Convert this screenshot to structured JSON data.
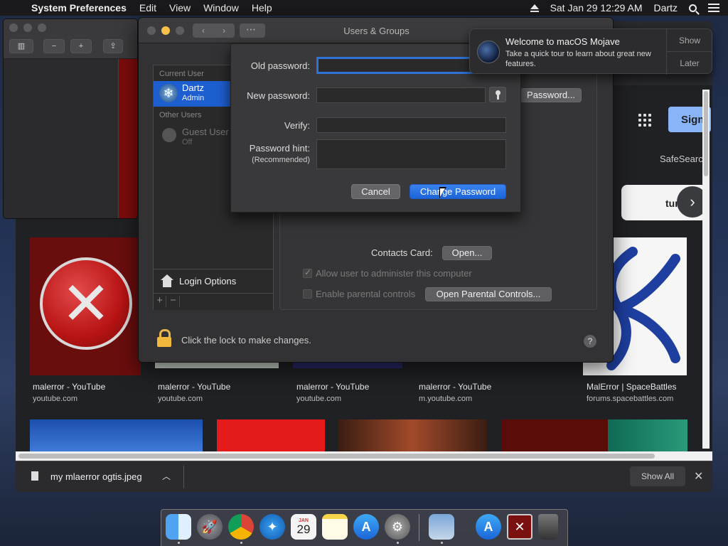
{
  "menubar": {
    "app_name": "System Preferences",
    "menus": [
      "Edit",
      "View",
      "Window",
      "Help"
    ],
    "clock": "Sat Jan 29  12:29 AM",
    "user": "Dartz"
  },
  "browser": {
    "results": [
      {
        "title": "malerror - YouTube",
        "source": "youtube.com"
      },
      {
        "title": "malerror - YouTube",
        "source": "youtube.com"
      },
      {
        "title": "malerror - YouTube",
        "source": "youtube.com"
      },
      {
        "title": "malerror - YouTube",
        "source": "m.youtube.com"
      },
      {
        "title": "MalError | SpaceBattles",
        "source": "forums.spacebattles.com"
      }
    ],
    "sign_in_label": "Sign",
    "safesearch_label": "SafeSearch",
    "chip_label": "tur",
    "download": {
      "file_name": "my mlaerror ogtis.jpeg",
      "show_all_label": "Show All"
    }
  },
  "users_groups": {
    "window_title": "Users & Groups",
    "current_user_header": "Current User",
    "current_user_name": "Dartz",
    "current_user_role": "Admin",
    "other_users_header": "Other Users",
    "guest_name": "Guest User",
    "guest_status": "Off",
    "login_options_label": "Login Options",
    "change_password_partial": "Password...",
    "contacts_card_label": "Contacts Card:",
    "open_button": "Open...",
    "allow_admin_label": "Allow user to administer this computer",
    "allow_admin_checked": true,
    "parental_controls_label": "Enable parental controls",
    "parental_controls_checked": false,
    "open_parental_button": "Open Parental Controls...",
    "lock_text": "Click the lock to make changes.",
    "help_label": "?"
  },
  "change_password_sheet": {
    "old_password_label": "Old password:",
    "old_password_value": "",
    "new_password_label": "New password:",
    "new_password_value": "",
    "verify_label": "Verify:",
    "verify_value": "",
    "hint_label": "Password hint:",
    "hint_sublabel": "(Recommended)",
    "hint_value": "",
    "cancel_label": "Cancel",
    "change_label": "Change Password"
  },
  "notification": {
    "title": "Welcome to macOS Mojave",
    "body": "Take a quick tour to learn about great new features.",
    "show_label": "Show",
    "later_label": "Later"
  },
  "dock": {
    "items": [
      {
        "name": "finder-icon"
      },
      {
        "name": "launchpad-icon"
      },
      {
        "name": "chrome-icon"
      },
      {
        "name": "safari-icon"
      },
      {
        "name": "calendar-icon",
        "label": "29",
        "month": "JAN"
      },
      {
        "name": "notes-icon"
      },
      {
        "name": "app-store-icon"
      },
      {
        "name": "system-preferences-icon"
      },
      {
        "name": "preview-icon"
      },
      {
        "name": "downloads-folder-icon"
      },
      {
        "name": "malerror-image-icon"
      },
      {
        "name": "trash-icon"
      }
    ]
  }
}
